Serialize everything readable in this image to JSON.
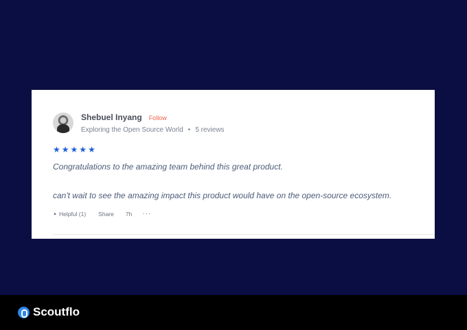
{
  "review": {
    "user_name": "Shebuel Inyang",
    "follow_label": "Follow",
    "tagline": "Exploring the Open Source World",
    "separator": "•",
    "reviews_count": "5 reviews",
    "rating": 5,
    "star_glyph": "★",
    "text_line1": "Congratulations to the amazing team behind this great product.",
    "text_line2": "can't wait to see the amazing impact this product would have on the open-source ecosystem.",
    "helpful_label": "Helpful (1)",
    "share_label": "Share",
    "time": "7h",
    "more_label": "···"
  },
  "footer": {
    "brand": "Scoutflo"
  },
  "colors": {
    "background": "#0b0e42",
    "star": "#1f5fd6",
    "follow": "#f0604a",
    "brand_accent": "#2f86e8"
  }
}
